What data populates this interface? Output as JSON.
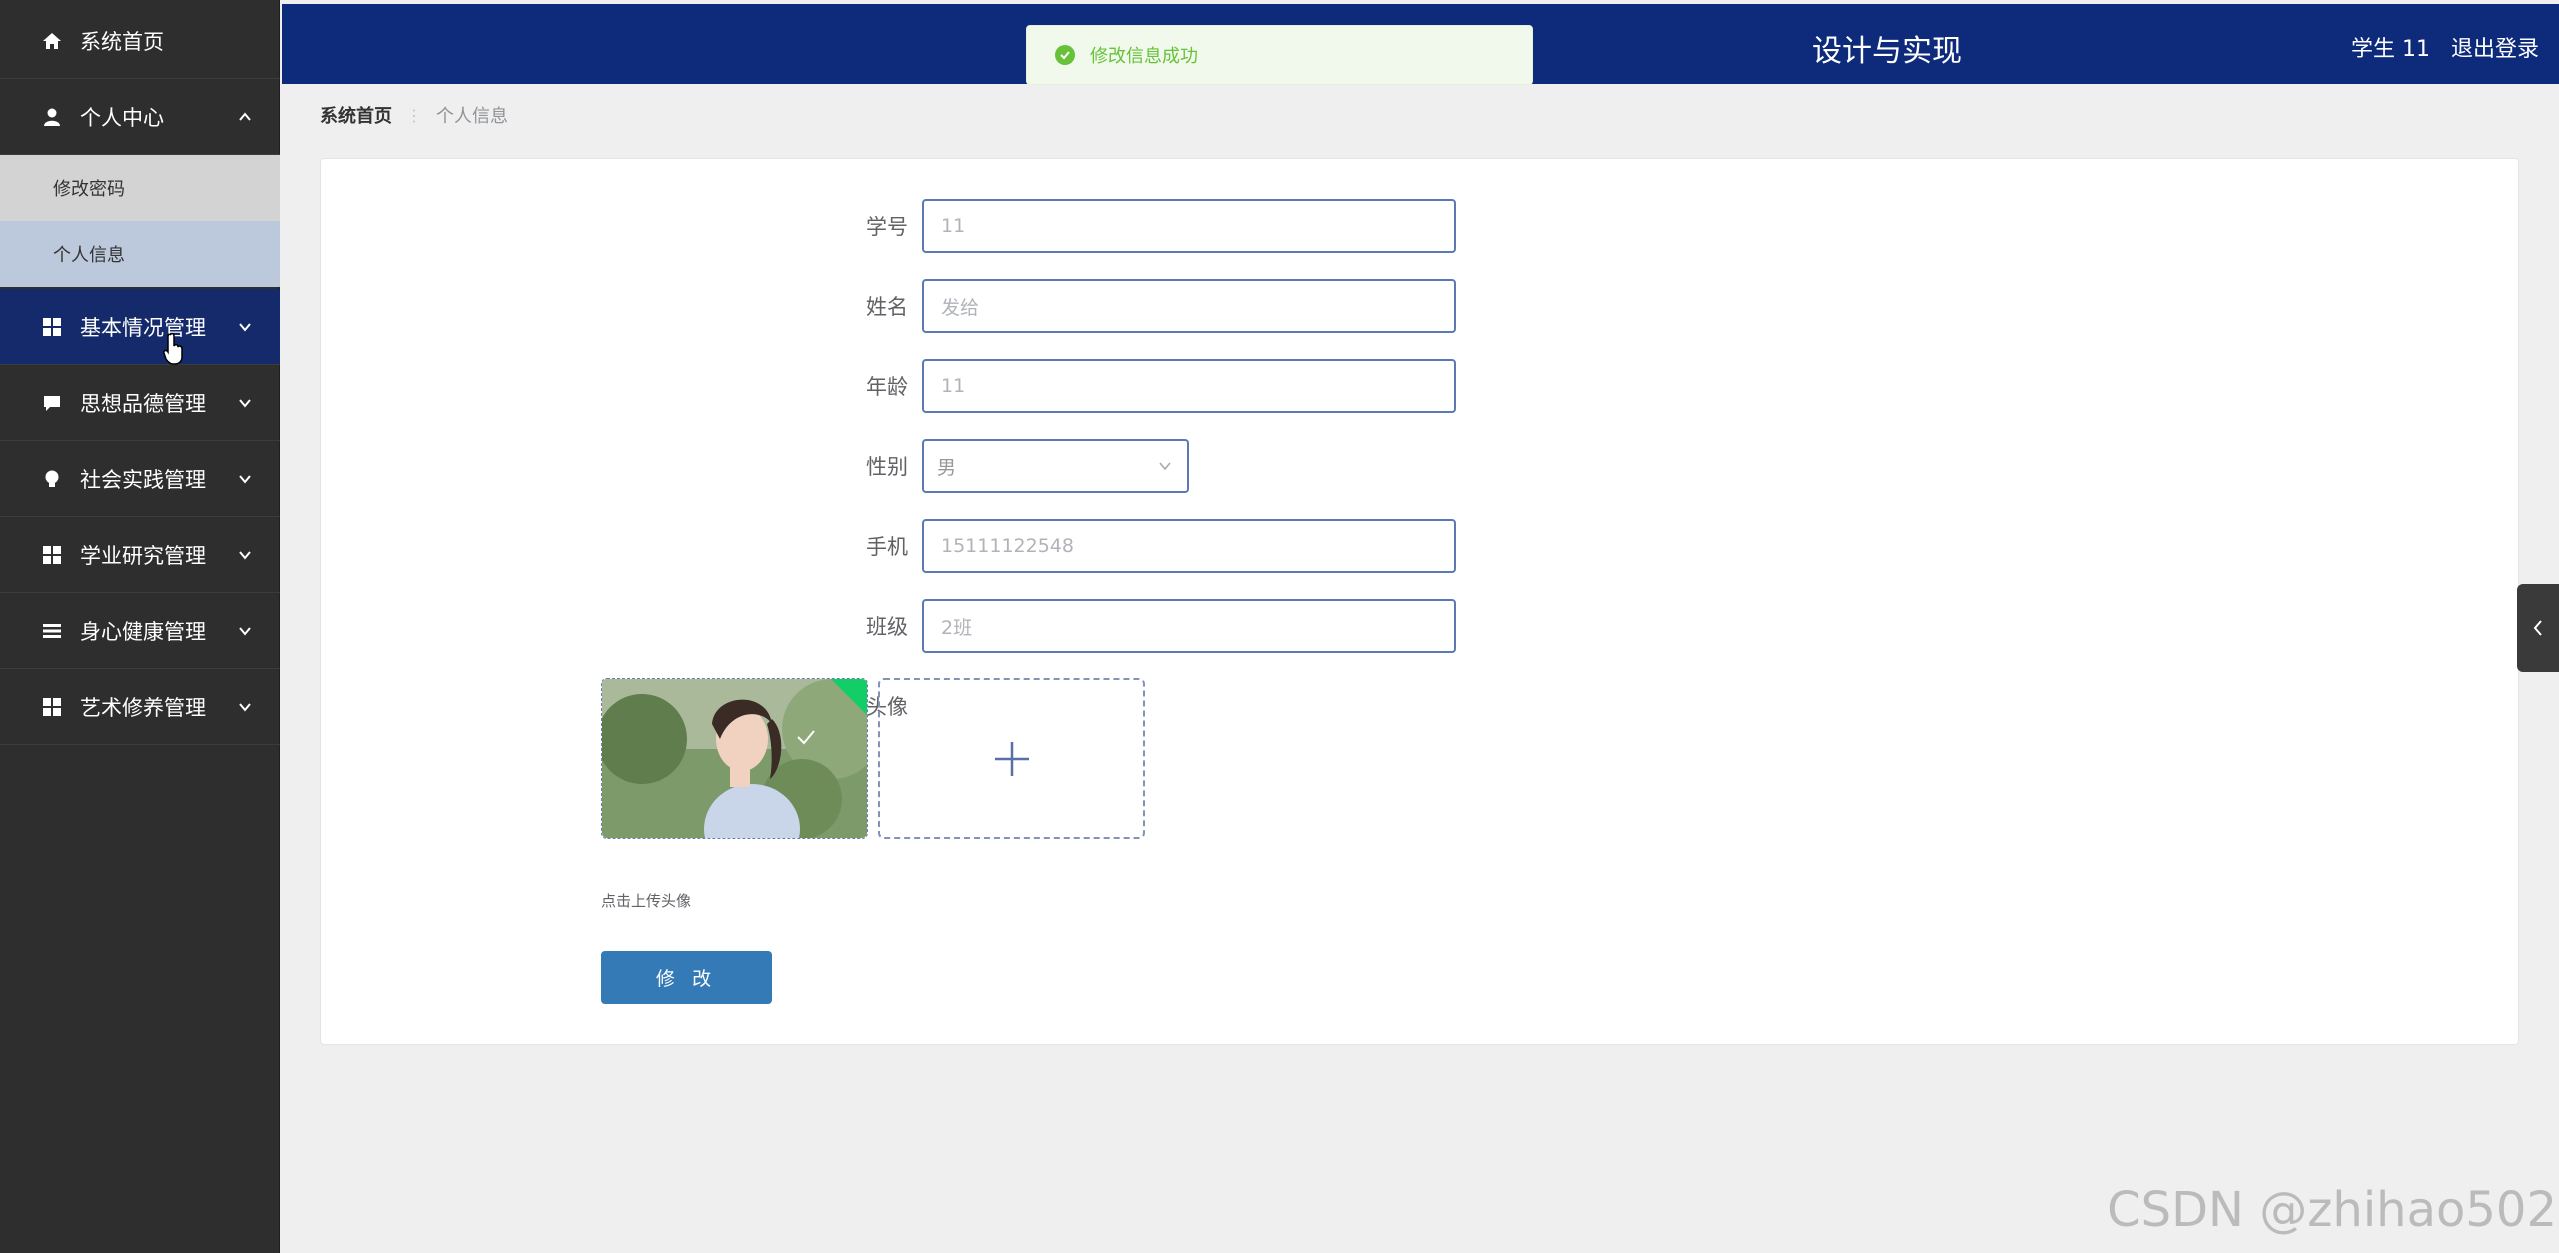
{
  "sidebar": {
    "items": [
      {
        "label": "系统首页",
        "icon": "home-icon"
      },
      {
        "label": "个人中心",
        "icon": "user-icon",
        "expanded": true,
        "children": [
          {
            "label": "修改密码"
          },
          {
            "label": "个人信息",
            "active": true
          }
        ]
      },
      {
        "label": "基本情况管理",
        "icon": "grid-icon"
      },
      {
        "label": "思想品德管理",
        "icon": "chat-icon"
      },
      {
        "label": "社会实践管理",
        "icon": "bulb-icon"
      },
      {
        "label": "学业研究管理",
        "icon": "grid-icon"
      },
      {
        "label": "身心健康管理",
        "icon": "list-icon"
      },
      {
        "label": "艺术修养管理",
        "icon": "grid-icon"
      }
    ]
  },
  "header": {
    "title": "设计与实现",
    "user": "学生 11",
    "logout": "退出登录"
  },
  "toast": {
    "message": "修改信息成功",
    "type": "success"
  },
  "breadcrumb": {
    "home": "系统首页",
    "current": "个人信息"
  },
  "form": {
    "student_id": {
      "label": "学号",
      "value": "11"
    },
    "name": {
      "label": "姓名",
      "value": "发给"
    },
    "age": {
      "label": "年龄",
      "value": "11"
    },
    "gender": {
      "label": "性别",
      "value": "男"
    },
    "phone": {
      "label": "手机",
      "value": "15111122548"
    },
    "class": {
      "label": "班级",
      "value": "2班"
    },
    "avatar": {
      "label": "头像",
      "tip": "点击上传头像"
    },
    "submit_label": "修 改"
  },
  "watermark": "CSDN @zhihao502",
  "colors": {
    "header_bg": "#0d2a7b",
    "sidebar_bg": "#2e2e2e",
    "button": "#337ab7",
    "success": "#67c23a"
  }
}
